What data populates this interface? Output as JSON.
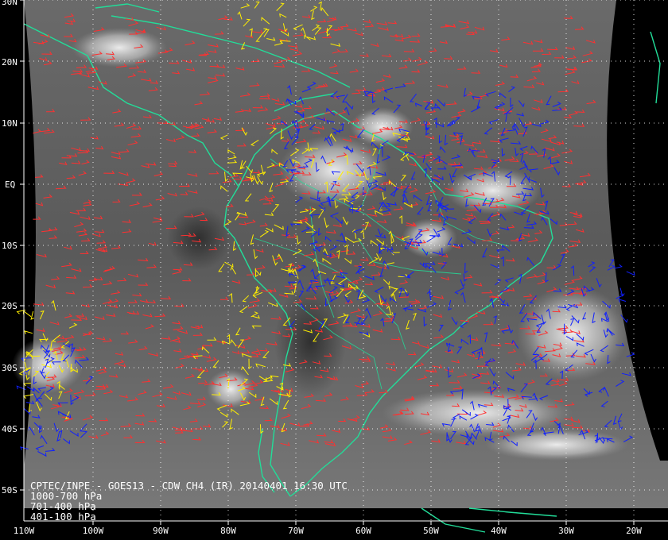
{
  "map": {
    "caption": "CPTEC/INPE - GOES13 - CDW CH4 (IR) 20140401 16:30 UTC",
    "latitude_labels": [
      "30N",
      "20N",
      "10N",
      "EQ",
      "10S",
      "20S",
      "30S",
      "40S",
      "50S"
    ],
    "longitude_labels": [
      "110W",
      "100W",
      "90W",
      "80W",
      "70W",
      "60W",
      "50W",
      "40W",
      "30W",
      "20W"
    ],
    "legend": [
      {
        "label": "1000-700 hPa",
        "color": "#ff3030"
      },
      {
        "label": "701-400 hPa",
        "color": "#ffee00"
      },
      {
        "label": "401-100 hPa",
        "color": "#1020ff"
      }
    ],
    "colors": {
      "background": "#000000",
      "coastline": "#22dd99",
      "grid": "#ffffff"
    }
  }
}
